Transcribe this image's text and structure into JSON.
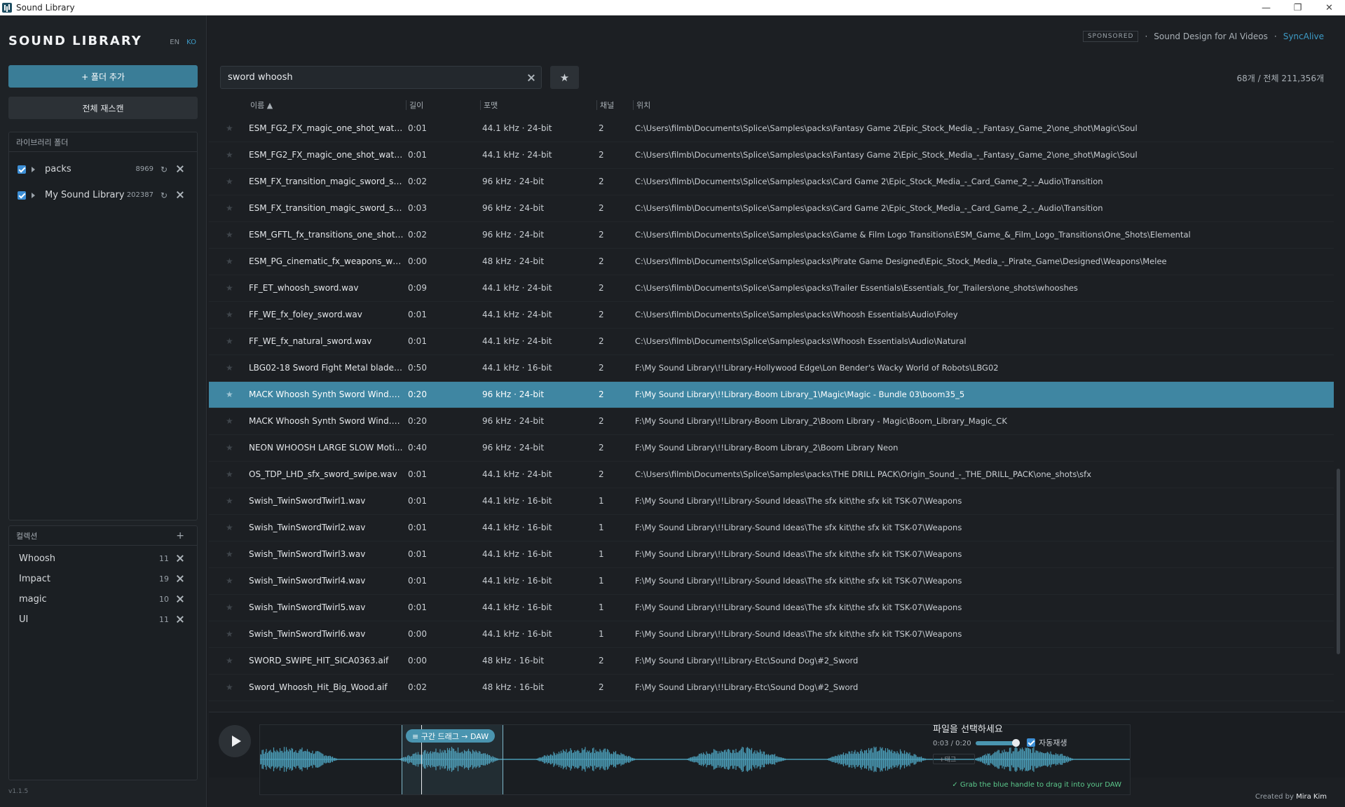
{
  "window": {
    "title": "Sound Library",
    "minimize_icon": "minimize-icon",
    "maximize_icon": "restore-icon",
    "close_icon": "close-icon"
  },
  "sidebar": {
    "brand": "SOUND LIBRARY",
    "lang_en": "EN",
    "lang_ko": "KO",
    "add_folder_label": "+ 폴더 추가",
    "rescan_label": "전체 재스캔",
    "folders_title": "라이브러리 폴더",
    "folders": [
      {
        "name": "packs",
        "count": "8969",
        "checked": true
      },
      {
        "name": "My Sound Library",
        "count": "202387",
        "checked": true
      }
    ],
    "collections_title": "컬렉션",
    "collections_add": "+",
    "collections": [
      {
        "name": "Whoosh",
        "count": "11"
      },
      {
        "name": "Impact",
        "count": "19"
      },
      {
        "name": "magic",
        "count": "10"
      },
      {
        "name": "UI",
        "count": "11"
      }
    ],
    "version": "v1.1.5"
  },
  "header": {
    "sponsor_badge": "SPONSORED",
    "sponsor_dot1": "·",
    "sponsor_text": "Sound Design for AI Videos",
    "sponsor_dot2": "·",
    "sponsor_link": "SyncAlive"
  },
  "search": {
    "value": "sword whoosh",
    "favorite_icon": "star-icon"
  },
  "result_count": "68개 / 전체 211,356개",
  "columns": {
    "name": "이름 ▲",
    "duration": "길이",
    "format": "포맷",
    "channels": "채널",
    "location": "위치"
  },
  "rows": [
    {
      "name": "ESM_FG2_FX_magic_one_shot_water...",
      "duration": "0:01",
      "format": "44.1 kHz · 24-bit",
      "channels": "2",
      "location": "C:\\Users\\filmb\\Documents\\Splice\\Samples\\packs\\Fantasy Game 2\\Epic_Stock_Media_-_Fantasy_Game_2\\one_shot\\Magic\\Soul"
    },
    {
      "name": "ESM_FG2_FX_magic_one_shot_water...",
      "duration": "0:01",
      "format": "44.1 kHz · 24-bit",
      "channels": "2",
      "location": "C:\\Users\\filmb\\Documents\\Splice\\Samples\\packs\\Fantasy Game 2\\Epic_Stock_Media_-_Fantasy_Game_2\\one_shot\\Magic\\Soul"
    },
    {
      "name": "ESM_FX_transition_magic_sword_shi...",
      "duration": "0:02",
      "format": "96 kHz · 24-bit",
      "channels": "2",
      "location": "C:\\Users\\filmb\\Documents\\Splice\\Samples\\packs\\Card Game 2\\Epic_Stock_Media_-_Card_Game_2_-_Audio\\Transition"
    },
    {
      "name": "ESM_FX_transition_magic_sword_shi...",
      "duration": "0:03",
      "format": "96 kHz · 24-bit",
      "channels": "2",
      "location": "C:\\Users\\filmb\\Documents\\Splice\\Samples\\packs\\Card Game 2\\Epic_Stock_Media_-_Card_Game_2_-_Audio\\Transition"
    },
    {
      "name": "ESM_GFTL_fx_transitions_one_shots_...",
      "duration": "0:02",
      "format": "96 kHz · 24-bit",
      "channels": "2",
      "location": "C:\\Users\\filmb\\Documents\\Splice\\Samples\\packs\\Game & Film Logo Transitions\\ESM_Game_&_Film_Logo_Transitions\\One_Shots\\Elemental"
    },
    {
      "name": "ESM_PG_cinematic_fx_weapons_war...",
      "duration": "0:00",
      "format": "48 kHz · 24-bit",
      "channels": "2",
      "location": "C:\\Users\\filmb\\Documents\\Splice\\Samples\\packs\\Pirate Game Designed\\Epic_Stock_Media_-_Pirate_Game\\Designed\\Weapons\\Melee"
    },
    {
      "name": "FF_ET_whoosh_sword.wav",
      "duration": "0:09",
      "format": "44.1 kHz · 24-bit",
      "channels": "2",
      "location": "C:\\Users\\filmb\\Documents\\Splice\\Samples\\packs\\Trailer Essentials\\Essentials_for_Trailers\\one_shots\\whooshes"
    },
    {
      "name": "FF_WE_fx_foley_sword.wav",
      "duration": "0:01",
      "format": "44.1 kHz · 24-bit",
      "channels": "2",
      "location": "C:\\Users\\filmb\\Documents\\Splice\\Samples\\packs\\Whoosh Essentials\\Audio\\Foley"
    },
    {
      "name": "FF_WE_fx_natural_sword.wav",
      "duration": "0:01",
      "format": "44.1 kHz · 24-bit",
      "channels": "2",
      "location": "C:\\Users\\filmb\\Documents\\Splice\\Samples\\packs\\Whoosh Essentials\\Audio\\Natural"
    },
    {
      "name": "LBG02-18 Sword Fight Metal blade ...",
      "duration": "0:50",
      "format": "44.1 kHz · 16-bit",
      "channels": "2",
      "location": "F:\\My Sound Library\\!!Library-Hollywood Edge\\Lon Bender's Wacky World of Robots\\LBG02"
    },
    {
      "name": "MACK Whoosh Synth Sword Wind.w...",
      "duration": "0:20",
      "format": "96 kHz · 24-bit",
      "channels": "2",
      "location": "F:\\My Sound Library\\!!Library-Boom Library_1\\Magic\\Magic - Bundle 03\\boom35_5",
      "selected": true
    },
    {
      "name": "MACK Whoosh Synth Sword Wind.w...",
      "duration": "0:20",
      "format": "96 kHz · 24-bit",
      "channels": "2",
      "location": "F:\\My Sound Library\\!!Library-Boom Library_2\\Boom Library - Magic\\Boom_Library_Magic_CK"
    },
    {
      "name": "NEON WHOOSH LARGE SLOW Moti...",
      "duration": "0:40",
      "format": "96 kHz · 24-bit",
      "channels": "2",
      "location": "F:\\My Sound Library\\!!Library-Boom Library_2\\Boom Library Neon"
    },
    {
      "name": "OS_TDP_LHD_sfx_sword_swipe.wav",
      "duration": "0:01",
      "format": "44.1 kHz · 24-bit",
      "channels": "2",
      "location": "C:\\Users\\filmb\\Documents\\Splice\\Samples\\packs\\THE DRILL PACK\\Origin_Sound_-_THE_DRILL_PACK\\one_shots\\sfx"
    },
    {
      "name": "Swish_TwinSwordTwirl1.wav",
      "duration": "0:01",
      "format": "44.1 kHz · 16-bit",
      "channels": "1",
      "location": "F:\\My Sound Library\\!!Library-Sound Ideas\\The sfx kit\\the sfx kit TSK-07\\Weapons"
    },
    {
      "name": "Swish_TwinSwordTwirl2.wav",
      "duration": "0:01",
      "format": "44.1 kHz · 16-bit",
      "channels": "1",
      "location": "F:\\My Sound Library\\!!Library-Sound Ideas\\The sfx kit\\the sfx kit TSK-07\\Weapons"
    },
    {
      "name": "Swish_TwinSwordTwirl3.wav",
      "duration": "0:01",
      "format": "44.1 kHz · 16-bit",
      "channels": "1",
      "location": "F:\\My Sound Library\\!!Library-Sound Ideas\\The sfx kit\\the sfx kit TSK-07\\Weapons"
    },
    {
      "name": "Swish_TwinSwordTwirl4.wav",
      "duration": "0:01",
      "format": "44.1 kHz · 16-bit",
      "channels": "1",
      "location": "F:\\My Sound Library\\!!Library-Sound Ideas\\The sfx kit\\the sfx kit TSK-07\\Weapons"
    },
    {
      "name": "Swish_TwinSwordTwirl5.wav",
      "duration": "0:01",
      "format": "44.1 kHz · 16-bit",
      "channels": "1",
      "location": "F:\\My Sound Library\\!!Library-Sound Ideas\\The sfx kit\\the sfx kit TSK-07\\Weapons"
    },
    {
      "name": "Swish_TwinSwordTwirl6.wav",
      "duration": "0:00",
      "format": "44.1 kHz · 16-bit",
      "channels": "1",
      "location": "F:\\My Sound Library\\!!Library-Sound Ideas\\The sfx kit\\the sfx kit TSK-07\\Weapons"
    },
    {
      "name": "SWORD_SWIPE_HIT_SICA0363.aif",
      "duration": "0:00",
      "format": "48 kHz · 16-bit",
      "channels": "2",
      "location": "F:\\My Sound Library\\!!Library-Etc\\Sound Dog\\#2_Sword"
    },
    {
      "name": "Sword_Whoosh_Hit_Big_Wood.aif",
      "duration": "0:02",
      "format": "48 kHz · 16-bit",
      "channels": "2",
      "location": "F:\\My Sound Library\\!!Library-Etc\\Sound Dog\\#2_Sword"
    }
  ],
  "player": {
    "drag_pill": "≡ 구간 드래그 → DAW",
    "grab_hint": "✓ Grab the blue handle to drag it into your DAW",
    "file_prompt": "파일을 선택하세요",
    "time": "0:03 / 0:20",
    "volume": 0.87,
    "autoplay_label": "자동재생",
    "autoplay_checked": true,
    "tag_button": "+태그",
    "wave_color": "#4a9bb5"
  },
  "footer": {
    "created_by": "Created by",
    "author": "Mira Kim"
  },
  "colors": {
    "accent": "#3a7d97",
    "selected_row": "#3f86a2",
    "link": "#3d9bc6",
    "hint_green": "#5cc98c"
  }
}
